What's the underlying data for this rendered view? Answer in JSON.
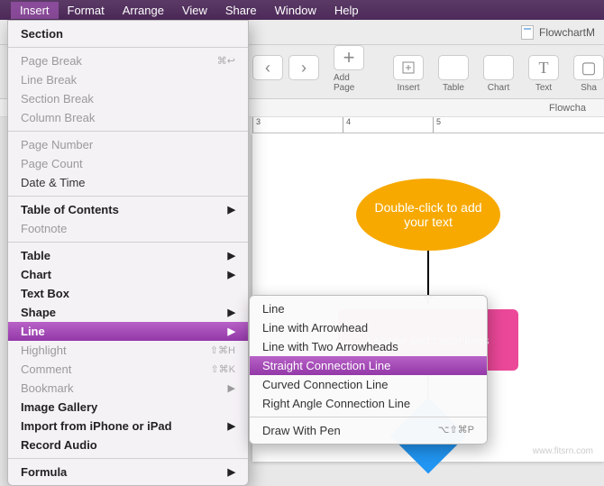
{
  "menubar": [
    "Insert",
    "Format",
    "Arrange",
    "View",
    "Share",
    "Window",
    "Help"
  ],
  "menubar_active": 0,
  "document_name": "FlowchartM",
  "subbar_text": "Flowcha",
  "toolbar": {
    "add_page": "Add Page",
    "insert": "Insert",
    "table": "Table",
    "chart": "Chart",
    "text": "Text",
    "shape": "Sha"
  },
  "ruler_ticks": [
    "3",
    "4",
    "5"
  ],
  "shapes": {
    "ellipse_text": "Double-click to add your text",
    "rect_text": "r shape and t your lines"
  },
  "insert_menu": [
    {
      "label": "Section",
      "strong": true
    },
    {
      "sep": true
    },
    {
      "label": "Page Break",
      "dim": true,
      "shortcut": "⌘↩"
    },
    {
      "label": "Line Break",
      "dim": true
    },
    {
      "label": "Section Break",
      "dim": true
    },
    {
      "label": "Column Break",
      "dim": true
    },
    {
      "sep": true
    },
    {
      "label": "Page Number",
      "dim": true
    },
    {
      "label": "Page Count",
      "dim": true
    },
    {
      "label": "Date & Time"
    },
    {
      "sep": true
    },
    {
      "label": "Table of Contents",
      "sub": true,
      "strong": true
    },
    {
      "label": "Footnote",
      "dim": true
    },
    {
      "sep": true
    },
    {
      "label": "Table",
      "sub": true,
      "strong": true
    },
    {
      "label": "Chart",
      "sub": true,
      "strong": true
    },
    {
      "label": "Text Box",
      "strong": true
    },
    {
      "label": "Shape",
      "sub": true,
      "strong": true
    },
    {
      "label": "Line",
      "sub": true,
      "hl": true,
      "strong": true
    },
    {
      "label": "Highlight",
      "dim": true,
      "shortcut": "⇧⌘H"
    },
    {
      "label": "Comment",
      "dim": true,
      "shortcut": "⇧⌘K"
    },
    {
      "label": "Bookmark",
      "dim": true,
      "sub": true
    },
    {
      "label": "Image Gallery",
      "strong": true
    },
    {
      "label": "Import from iPhone or iPad",
      "sub": true,
      "strong": true
    },
    {
      "label": "Record Audio",
      "strong": true
    },
    {
      "sep": true
    },
    {
      "label": "Formula",
      "sub": true,
      "strong": true
    }
  ],
  "line_submenu": [
    {
      "label": "Line"
    },
    {
      "label": "Line with Arrowhead"
    },
    {
      "label": "Line with Two Arrowheads"
    },
    {
      "label": "Straight Connection Line",
      "hl": true
    },
    {
      "label": "Curved Connection Line"
    },
    {
      "label": "Right Angle Connection Line"
    },
    {
      "sep": true
    },
    {
      "label": "Draw With Pen",
      "shortcut": "⌥⇧⌘P"
    }
  ],
  "watermark": "www.fitsrn.com"
}
